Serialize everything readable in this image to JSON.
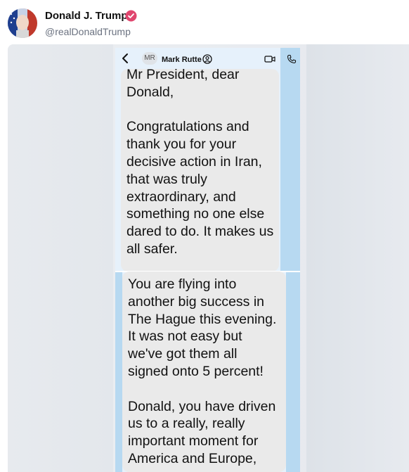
{
  "post": {
    "display_name": "Donald J. Trump",
    "handle": "@realDonaldTrump"
  },
  "chat": {
    "contact_initials": "MR",
    "contact_name": "Mark Rutte",
    "message_1": "Mr President, dear\nDonald,\n\nCongratulations and\nthank you for your\ndecisive action in Iran,\nthat was truly\nextraordinary, and\nsomething no one else\ndared to do.  It makes us\nall safer.",
    "message_2": "You are flying into\nanother big success in\nThe Hague this evening.\nIt was not easy but\nwe've got them all\nsigned onto 5 percent!\n\nDonald, you have driven\nus to a really, really\nimportant moment for\nAmerica and Europe,"
  },
  "icons": {
    "verified": "verified-badge-icon",
    "back": "chevron-left-icon",
    "contact": "contact-card-icon",
    "video": "video-call-icon",
    "phone": "phone-call-icon"
  },
  "colors": {
    "verified_badge": "#e0466e",
    "bubble": "#eaeaea",
    "chat_background": "#b7d9f1"
  }
}
